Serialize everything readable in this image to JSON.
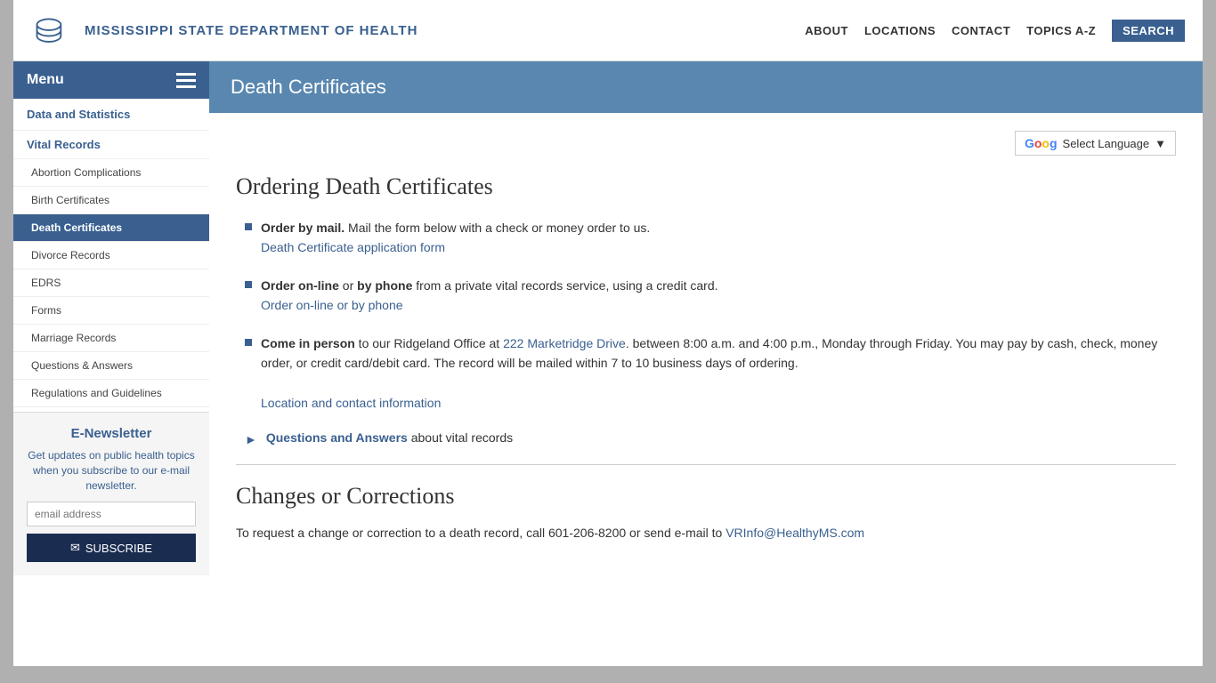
{
  "header": {
    "logo_text": "Mississippi State Department of Health",
    "nav": {
      "about": "ABOUT",
      "locations": "LOCATIONS",
      "contact": "CONTACT",
      "topics_az": "TOPICS A-Z",
      "search": "SEARCH"
    }
  },
  "sidebar": {
    "menu_label": "Menu",
    "section_title": "Data and Statistics",
    "parent_item": "Vital Records",
    "items": [
      {
        "label": "Abortion Complications",
        "active": false
      },
      {
        "label": "Birth Certificates",
        "active": false
      },
      {
        "label": "Death Certificates",
        "active": true
      },
      {
        "label": "Divorce Records",
        "active": false
      },
      {
        "label": "EDRS",
        "active": false
      },
      {
        "label": "Forms",
        "active": false
      },
      {
        "label": "Marriage Records",
        "active": false
      },
      {
        "label": "Questions & Answers",
        "active": false
      },
      {
        "label": "Regulations and Guidelines",
        "active": false
      }
    ],
    "enewsletter": {
      "title": "E-Newsletter",
      "text": "Get updates on public health topics when you subscribe to our e-mail newsletter.",
      "placeholder": "email address",
      "button_label": "SUBSCRIBE"
    }
  },
  "page": {
    "title": "Death Certificates",
    "language_selector": "Select Language",
    "heading1": "Ordering Death Certificates",
    "bullet1": {
      "strong": "Order by mail.",
      "text": " Mail the form below with a check or money order to us.",
      "link_text": "Death Certificate application form",
      "link_href": "#"
    },
    "bullet2": {
      "strong1": "Order on-line",
      "text1": " or ",
      "strong2": "by phone",
      "text2": " from a private vital records service, using a credit card.",
      "link_text": "Order on-line or by phone",
      "link_href": "#"
    },
    "bullet3": {
      "strong": "Come in person",
      "text1": " to our Ridgeland Office at ",
      "link_text": "222 Marketridge Drive",
      "link_href": "#",
      "text2": ". between 8:00 a.m. and 4:00 p.m., Monday through Friday. You may pay by cash, check, money order, or credit card/debit card. The record will be mailed within 7 to 10 business days of ordering.",
      "link2_text": "Location and contact information",
      "link2_href": "#"
    },
    "arrow1": {
      "link_text": "Questions and Answers",
      "text": " about vital records"
    },
    "heading2": "Changes or Corrections",
    "para2": "To request a change or correction to a death record, call 601-206-8200 or send e-mail to ",
    "email_link": "VRInfo@HealthyMS.com"
  }
}
